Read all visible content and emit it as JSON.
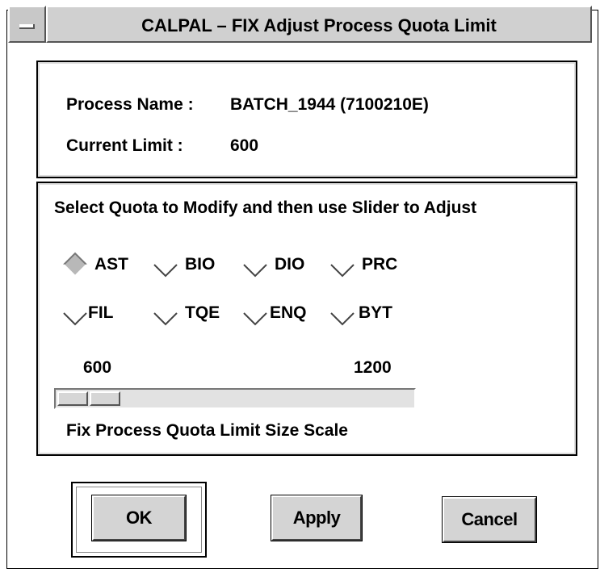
{
  "window": {
    "title": "CALPAL – FIX Adjust Process Quota Limit"
  },
  "info": {
    "process_name_label": "Process Name :",
    "process_name_value": "BATCH_1944 (7100210E)",
    "current_limit_label": "Current Limit :",
    "current_limit_value": "600"
  },
  "quota": {
    "instruction": "Select Quota to Modify and then use Slider to Adjust",
    "options": [
      {
        "label": "AST",
        "selected": true
      },
      {
        "label": "BIO",
        "selected": false
      },
      {
        "label": "DIO",
        "selected": false
      },
      {
        "label": "PRC",
        "selected": false
      },
      {
        "label": "FIL",
        "selected": false
      },
      {
        "label": "TQE",
        "selected": false
      },
      {
        "label": "ENQ",
        "selected": false
      },
      {
        "label": "BYT",
        "selected": false
      }
    ],
    "slider": {
      "min_label": "600",
      "max_label": "1200",
      "min": 600,
      "max": 1200,
      "value": 600,
      "caption": "Fix Process Quota Limit Size Scale"
    }
  },
  "buttons": {
    "ok": "OK",
    "apply": "Apply",
    "cancel": "Cancel"
  },
  "colors": {
    "face": "#d4d4d4",
    "selected_diamond": "#b8b8b8"
  }
}
